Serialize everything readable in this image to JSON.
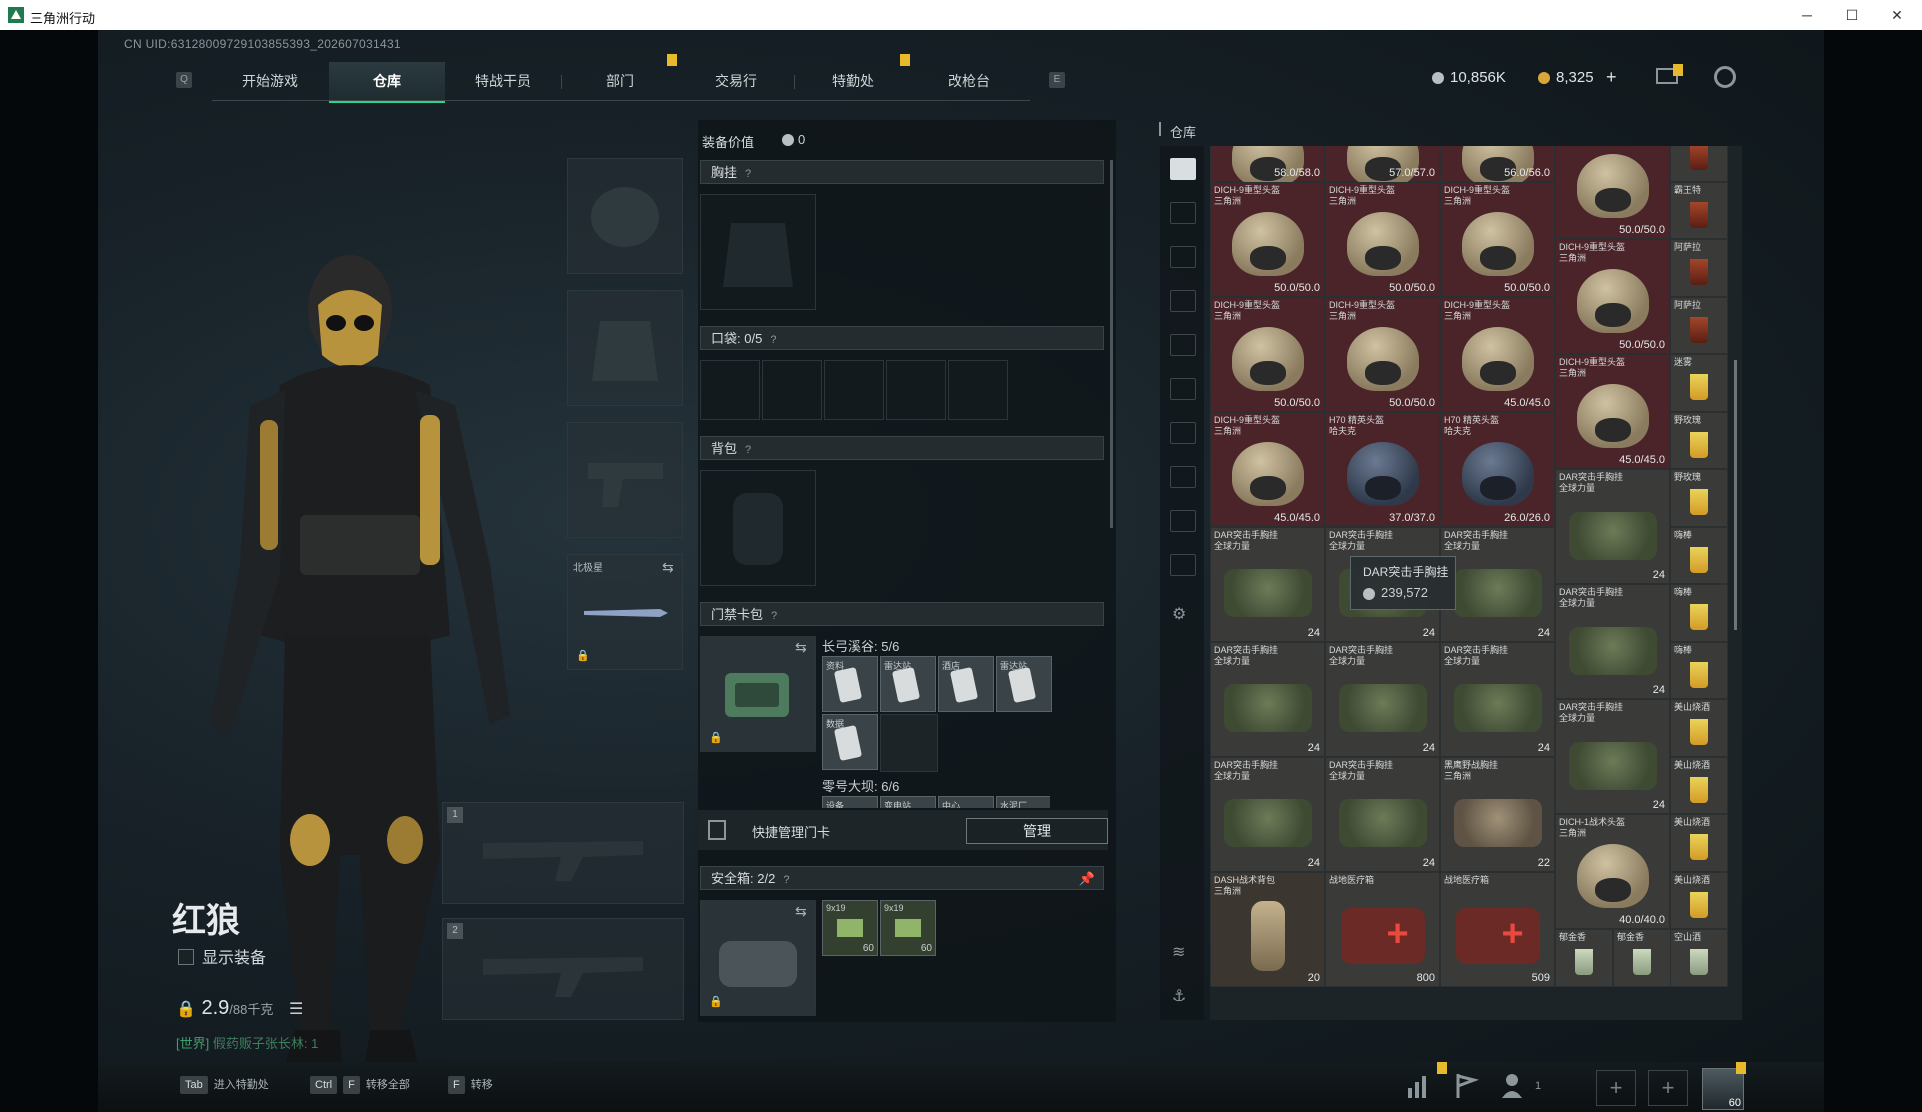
{
  "window": {
    "title": "三角洲行动",
    "controls": {
      "minimize": "─",
      "maximize": "☐",
      "close": "✕"
    }
  },
  "uid": "CN UID:6312800972910385539​3_202607031431",
  "nav": {
    "left_key": "Q",
    "right_key": "E",
    "tabs": [
      {
        "label": "开始游戏",
        "active": false
      },
      {
        "label": "仓库",
        "active": true
      },
      {
        "label": "特战干员",
        "active": false
      },
      {
        "label": "部门",
        "active": false
      },
      {
        "label": "交易行",
        "active": false
      },
      {
        "label": "特勤处",
        "active": false
      },
      {
        "label": "改枪台",
        "active": false
      }
    ]
  },
  "currency": {
    "silver": "10,856K",
    "gold": "8,325",
    "add": "+"
  },
  "character": {
    "name": "红狼",
    "show_equipment": "显示装备",
    "weight": "2.9",
    "weight_max": "/88千克",
    "chat_channel": "[世界]",
    "chat_message": "假药贩子张长林: 1"
  },
  "gear": {
    "melee_label": "北极星",
    "weapon_slot_1": "1",
    "weapon_slot_2": "2"
  },
  "middle": {
    "equip_value_label": "装备价值",
    "equip_value": "0",
    "chest_rig": "胸挂",
    "pockets": "口袋:",
    "pockets_count": "0/5",
    "backpack": "背包",
    "keycard_bag": "门禁卡包",
    "question": "?",
    "group1_title": "长弓溪谷: 5/6",
    "group1_cards": [
      "资料",
      "雷达站",
      "酒店",
      "雷达站",
      "数据"
    ],
    "group2_title": "零号大坝: 6/6",
    "group2_cards": [
      "设备",
      "变电站",
      "中心",
      "水泥厂"
    ],
    "quick_manage": "快捷管理门卡",
    "manage_button": "管理",
    "safe_box": "安全箱:",
    "safe_box_count": "2/2",
    "ammo": [
      {
        "label": "9x19",
        "count": "60"
      },
      {
        "label": "9x19",
        "count": "60"
      }
    ]
  },
  "warehouse": {
    "label": "仓库",
    "tooltip": {
      "name": "DAR突击手胸挂",
      "price": "239,572"
    },
    "items": [
      {
        "name": "",
        "sub": "",
        "value": "58.0/58.0",
        "kind": "helm",
        "bg": "red"
      },
      {
        "name": "",
        "sub": "",
        "value": "57.0/57.0",
        "kind": "helm",
        "bg": "red"
      },
      {
        "name": "",
        "sub": "",
        "value": "56.0/56.0",
        "kind": "helm",
        "bg": "red"
      },
      {
        "name": "DICH-9重型头盔",
        "sub": "",
        "value": "50.0/50.0",
        "kind": "helm",
        "bg": "red"
      },
      {
        "name": "霸王特",
        "sub": "",
        "value": "",
        "kind": "drink-dark",
        "bg": "gray"
      },
      {
        "name": "DICH-9重型头盔",
        "sub": "三角洲",
        "value": "50.0/50.0",
        "kind": "helm",
        "bg": "red"
      },
      {
        "name": "DICH-9重型头盔",
        "sub": "三角洲",
        "value": "50.0/50.0",
        "kind": "helm",
        "bg": "red"
      },
      {
        "name": "DICH-9重型头盔",
        "sub": "三角洲",
        "value": "50.0/50.0",
        "kind": "helm",
        "bg": "red"
      },
      {
        "name": "霸王特",
        "sub": "",
        "value": "",
        "kind": "drink-dark",
        "bg": "gray"
      },
      {
        "name": "DICH-9重型头盔",
        "sub": "三角洲",
        "value": "50.0/50.0",
        "kind": "helm",
        "bg": "red"
      },
      {
        "name": "阿萨拉",
        "sub": "",
        "value": "",
        "kind": "drink-dark",
        "bg": "gray"
      },
      {
        "name": "DICH-9重型头盔",
        "sub": "三角洲",
        "value": "50.0/50.0",
        "kind": "helm",
        "bg": "red"
      },
      {
        "name": "DICH-9重型头盔",
        "sub": "三角洲",
        "value": "50.0/50.0",
        "kind": "helm",
        "bg": "red"
      },
      {
        "name": "DICH-9重型头盔",
        "sub": "三角洲",
        "value": "45.0/45.0",
        "kind": "helm",
        "bg": "red"
      },
      {
        "name": "阿萨拉",
        "sub": "",
        "value": "",
        "kind": "drink-dark",
        "bg": "gray"
      },
      {
        "name": "DICH-9重型头盔",
        "sub": "三角洲",
        "value": "45.0/45.0",
        "kind": "helm",
        "bg": "red"
      },
      {
        "name": "迷雾",
        "sub": "",
        "value": "",
        "kind": "drink",
        "bg": "gray"
      },
      {
        "name": "DICH-9重型头盔",
        "sub": "三角洲",
        "value": "45.0/45.0",
        "kind": "helm",
        "bg": "red"
      },
      {
        "name": "H70 精英头盔",
        "sub": "哈夫克",
        "value": "37.0/37.0",
        "kind": "helm-h70",
        "bg": "red"
      },
      {
        "name": "H70 精英头盔",
        "sub": "哈夫克",
        "value": "26.0/26.0",
        "kind": "helm-h70",
        "bg": "red"
      },
      {
        "name": "野玫瑰",
        "sub": "",
        "value": "",
        "kind": "drink",
        "bg": "gray"
      },
      {
        "name": "DAR突击手胸挂",
        "sub": "全球力量",
        "value": "24",
        "kind": "vest",
        "bg": "gray"
      },
      {
        "name": "野玫瑰",
        "sub": "",
        "value": "",
        "kind": "drink",
        "bg": "gray"
      },
      {
        "name": "DAR突击手胸挂",
        "sub": "全球力量",
        "value": "24",
        "kind": "vest",
        "bg": "gray"
      },
      {
        "name": "DAR突击手胸挂",
        "sub": "全球力量",
        "value": "24",
        "kind": "vest",
        "bg": "gray"
      },
      {
        "name": "DAR突击手胸挂",
        "sub": "全球力量",
        "value": "24",
        "kind": "vest",
        "bg": "gray"
      },
      {
        "name": "嗨棒",
        "sub": "",
        "value": "",
        "kind": "drink",
        "bg": "gray"
      },
      {
        "name": "DAR突击手胸挂",
        "sub": "全球力量",
        "value": "24",
        "kind": "vest",
        "bg": "gray"
      },
      {
        "name": "嗨棒",
        "sub": "",
        "value": "",
        "kind": "drink",
        "bg": "gray"
      },
      {
        "name": "DAR突击手胸挂",
        "sub": "全球力量",
        "value": "24",
        "kind": "vest",
        "bg": "gray"
      },
      {
        "name": "DAR突击手胸挂",
        "sub": "全球力量",
        "value": "24",
        "kind": "vest",
        "bg": "gray"
      },
      {
        "name": "DAR突击手胸挂",
        "sub": "全球力量",
        "value": "24",
        "kind": "vest",
        "bg": "gray"
      },
      {
        "name": "嗨棒",
        "sub": "",
        "value": "",
        "kind": "drink",
        "bg": "gray"
      },
      {
        "name": "DAR突击手胸挂",
        "sub": "全球力量",
        "value": "24",
        "kind": "vest",
        "bg": "gray"
      },
      {
        "name": "美山烧酒",
        "sub": "",
        "value": "",
        "kind": "drink",
        "bg": "gray"
      },
      {
        "name": "DAR突击手胸挂",
        "sub": "全球力量",
        "value": "24",
        "kind": "vest",
        "bg": "gray"
      },
      {
        "name": "DAR突击手胸挂",
        "sub": "全球力量",
        "value": "24",
        "kind": "vest",
        "bg": "gray"
      },
      {
        "name": "黑鹰野战胸挂",
        "sub": "三角洲",
        "value": "22",
        "kind": "vest-bw",
        "bg": "gray"
      },
      {
        "name": "美山烧酒",
        "sub": "",
        "value": "",
        "kind": "drink",
        "bg": "gray"
      },
      {
        "name": "DICH-1战术头盔",
        "sub": "三角洲",
        "value": "40.0/40.0",
        "kind": "helm",
        "bg": "gray"
      },
      {
        "name": "美山烧酒",
        "sub": "",
        "value": "",
        "kind": "drink",
        "bg": "gray"
      },
      {
        "name": "DASH战术背包",
        "sub": "三角洲",
        "value": "20",
        "kind": "pack",
        "bg": "brown"
      },
      {
        "name": "战地医疗箱",
        "sub": "",
        "value": "800",
        "kind": "medkit",
        "bg": "gray"
      },
      {
        "name": "战地医疗箱",
        "sub": "",
        "value": "509",
        "kind": "medkit",
        "bg": "gray"
      },
      {
        "name": "美山烧酒",
        "sub": "",
        "value": "",
        "kind": "drink",
        "bg": "gray"
      },
      {
        "name": "郁金香",
        "sub": "",
        "value": "",
        "kind": "drink-pale",
        "bg": "gray"
      },
      {
        "name": "郁金香",
        "sub": "",
        "value": "",
        "kind": "drink-pale",
        "bg": "gray"
      },
      {
        "name": "空山酒",
        "sub": "",
        "value": "",
        "kind": "drink-pale",
        "bg": "gray"
      }
    ]
  },
  "bottom": {
    "hints": [
      {
        "key": "Tab",
        "label": "进入特勤处"
      },
      {
        "key": "Ctrl",
        "key2": "F",
        "label": "转移全部"
      },
      {
        "key": "F",
        "label": "转移"
      }
    ],
    "friends_count": "1",
    "avatar_level": "60"
  },
  "colors": {
    "accent": "#2fd28f",
    "notification": "#e8b92a",
    "warehouse_red": "#4a2428"
  }
}
